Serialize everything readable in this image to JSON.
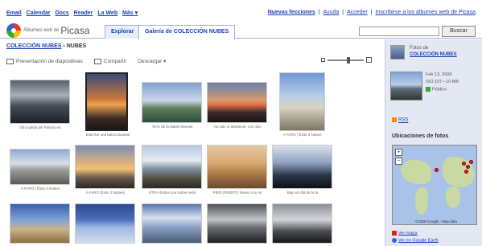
{
  "google_links": [
    "Email",
    "Calendar",
    "Docs",
    "Reader",
    "La Web",
    "Más ▾"
  ],
  "user_links": [
    "Nuevas fecciones",
    "|",
    "Ayuda",
    "|",
    "Acceder",
    "|",
    "Inscribirse a los álbumes web de Picasa"
  ],
  "logo": {
    "small_text": "Álbumes web de",
    "big_text": "Picasa"
  },
  "tabs": {
    "explore": "Explorar",
    "gallery": "Galería de COLECCIÓN NUBES"
  },
  "search": {
    "value": "",
    "placeholder": "",
    "button": "Buscar"
  },
  "breadcrumb": {
    "parent": "COLECCIÓN NUBES",
    "separator": "›",
    "current": "NUBES"
  },
  "toolbar": {
    "slideshow": "Presentación de diapositivas",
    "share": "Compartir",
    "download": "Descargar ▾"
  },
  "captions": [
    "Otra salida del Palacio en",
    "",
    "Torre de la Malas Mareas",
    "Ha sido el atardecer, con olas",
    "",
    "Esta fue una batría durante",
    "",
    "A FARO | Éxito 3 Nubes",
    "A FARO | Éxito 3 Nubes",
    "A FARO (Éxito 3 Nubes)",
    "OTRA Éxitos con Nubes está",
    "PIER (PUERTO Nuevo con un",
    "Bajo un día de la la"
  ],
  "sidebar": {
    "author_label": "Fotos de",
    "author_name": "COLECCIÓN NUBES",
    "photo_date": "Feb 13, 2009",
    "photo_exif": "ISO 107 • 10 MB",
    "photo_visibility": "Público",
    "rss": "RSS",
    "map_heading": "Ubicaciones de fotos",
    "map_credit": "©2009 Google · Map data",
    "map_zoom_in": "+",
    "map_zoom_out": "−",
    "view_map": "Ver mapa",
    "view_earth": "Ver en Google Earth"
  },
  "colors": {
    "link": "#1a3fb5",
    "sidebar_bg": "#e3e8f2",
    "tab_border": "#9fb3de"
  }
}
